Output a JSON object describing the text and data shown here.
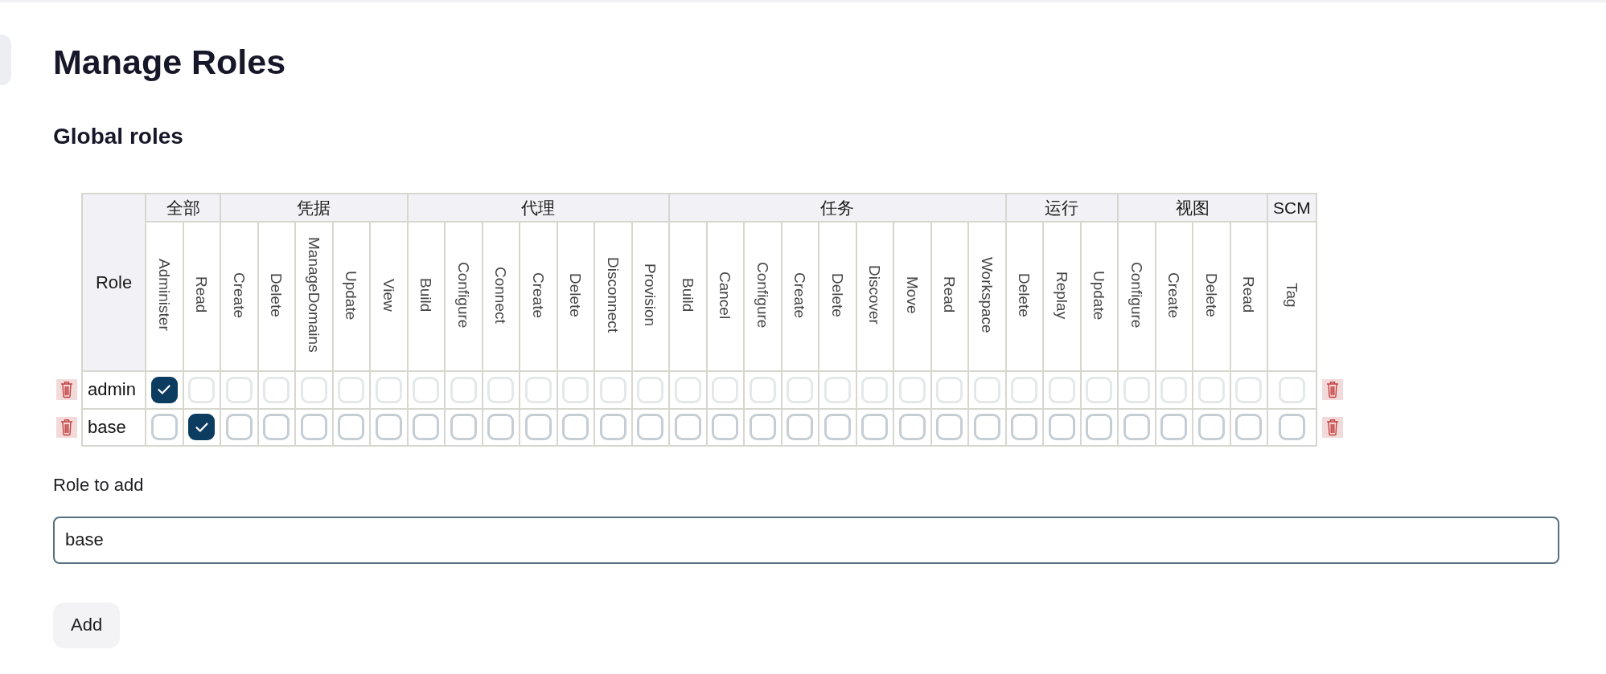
{
  "page": {
    "title": "Manage Roles"
  },
  "global_roles": {
    "heading": "Global roles",
    "table": {
      "role_header": "Role",
      "groups": [
        {
          "label": "全部",
          "permissions": [
            "Administer",
            "Read"
          ]
        },
        {
          "label": "凭据",
          "permissions": [
            "Create",
            "Delete",
            "ManageDomains",
            "Update",
            "View"
          ]
        },
        {
          "label": "代理",
          "permissions": [
            "Build",
            "Configure",
            "Connect",
            "Create",
            "Delete",
            "Disconnect",
            "Provision"
          ]
        },
        {
          "label": "任务",
          "permissions": [
            "Build",
            "Cancel",
            "Configure",
            "Create",
            "Delete",
            "Discover",
            "Move",
            "Read",
            "Workspace"
          ]
        },
        {
          "label": "运行",
          "permissions": [
            "Delete",
            "Replay",
            "Update"
          ]
        },
        {
          "label": "视图",
          "permissions": [
            "Configure",
            "Create",
            "Delete",
            "Read"
          ]
        },
        {
          "label": "SCM",
          "permissions": [
            "Tag"
          ]
        }
      ],
      "rows": [
        {
          "name": "admin",
          "permissions": [
            {
              "checked": true,
              "disabled": false
            },
            {
              "checked": false,
              "disabled": true
            },
            {
              "checked": false,
              "disabled": true
            },
            {
              "checked": false,
              "disabled": true
            },
            {
              "checked": false,
              "disabled": true
            },
            {
              "checked": false,
              "disabled": true
            },
            {
              "checked": false,
              "disabled": true
            },
            {
              "checked": false,
              "disabled": true
            },
            {
              "checked": false,
              "disabled": true
            },
            {
              "checked": false,
              "disabled": true
            },
            {
              "checked": false,
              "disabled": true
            },
            {
              "checked": false,
              "disabled": true
            },
            {
              "checked": false,
              "disabled": true
            },
            {
              "checked": false,
              "disabled": true
            },
            {
              "checked": false,
              "disabled": true
            },
            {
              "checked": false,
              "disabled": true
            },
            {
              "checked": false,
              "disabled": true
            },
            {
              "checked": false,
              "disabled": true
            },
            {
              "checked": false,
              "disabled": true
            },
            {
              "checked": false,
              "disabled": true
            },
            {
              "checked": false,
              "disabled": true
            },
            {
              "checked": false,
              "disabled": true
            },
            {
              "checked": false,
              "disabled": true
            },
            {
              "checked": false,
              "disabled": true
            },
            {
              "checked": false,
              "disabled": true
            },
            {
              "checked": false,
              "disabled": true
            },
            {
              "checked": false,
              "disabled": true
            },
            {
              "checked": false,
              "disabled": true
            },
            {
              "checked": false,
              "disabled": true
            },
            {
              "checked": false,
              "disabled": true
            },
            {
              "checked": false,
              "disabled": true
            }
          ]
        },
        {
          "name": "base",
          "permissions": [
            {
              "checked": false,
              "disabled": false
            },
            {
              "checked": true,
              "disabled": false
            },
            {
              "checked": false,
              "disabled": false
            },
            {
              "checked": false,
              "disabled": false
            },
            {
              "checked": false,
              "disabled": false
            },
            {
              "checked": false,
              "disabled": false
            },
            {
              "checked": false,
              "disabled": false
            },
            {
              "checked": false,
              "disabled": false
            },
            {
              "checked": false,
              "disabled": false
            },
            {
              "checked": false,
              "disabled": false
            },
            {
              "checked": false,
              "disabled": false
            },
            {
              "checked": false,
              "disabled": false
            },
            {
              "checked": false,
              "disabled": false
            },
            {
              "checked": false,
              "disabled": false
            },
            {
              "checked": false,
              "disabled": false
            },
            {
              "checked": false,
              "disabled": false
            },
            {
              "checked": false,
              "disabled": false
            },
            {
              "checked": false,
              "disabled": false
            },
            {
              "checked": false,
              "disabled": false
            },
            {
              "checked": false,
              "disabled": false
            },
            {
              "checked": false,
              "disabled": false
            },
            {
              "checked": false,
              "disabled": false
            },
            {
              "checked": false,
              "disabled": false
            },
            {
              "checked": false,
              "disabled": false
            },
            {
              "checked": false,
              "disabled": false
            },
            {
              "checked": false,
              "disabled": false
            },
            {
              "checked": false,
              "disabled": false
            },
            {
              "checked": false,
              "disabled": false
            },
            {
              "checked": false,
              "disabled": false
            },
            {
              "checked": false,
              "disabled": false
            },
            {
              "checked": false,
              "disabled": false
            }
          ]
        }
      ]
    }
  },
  "role_to_add": {
    "label": "Role to add",
    "value": "base"
  },
  "buttons": [
    {
      "label": "Add"
    }
  ]
}
